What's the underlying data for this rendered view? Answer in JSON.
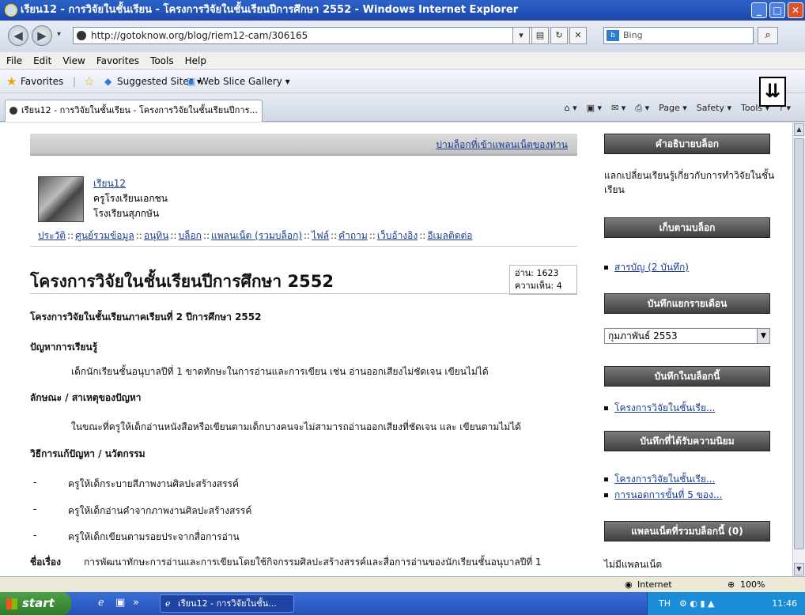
{
  "window": {
    "title": "เรียน12 - การวิจัยในชั้นเรียน - โครงการวิจัยในชั้นเรียนปีการศึกษา 2552 - Windows Internet Explorer"
  },
  "addressbar": {
    "url": "http://gotoknow.org/blog/riem12-cam/306165",
    "search_placeholder": "Bing"
  },
  "menu": [
    "File",
    "Edit",
    "View",
    "Favorites",
    "Tools",
    "Help"
  ],
  "favbar": {
    "favorites": "Favorites",
    "suggested": "Suggested Sites ▾",
    "webslice": "Web Slice Gallery ▾"
  },
  "tab": {
    "label": "เรียน12 - การวิจัยในชั้นเรียน - โครงการวิจัยในชั้นเรียนปีการ..."
  },
  "commandbar": [
    "Page ▾",
    "Safety ▾",
    "Tools ▾"
  ],
  "page": {
    "banner_link": "บ่ามล็อกที่เข้าแพลนเน็ตของท่าน",
    "profile": {
      "name": "เรียน12",
      "role": "ครูโรงเรียนเอกชน",
      "school": "โรงเรียนสุภกษัน"
    },
    "navlinks": [
      "ประวัติ",
      "ศูนย์รวมข้อมูล",
      "อนุทิน",
      "บล็อก",
      "แพลนเน็ต (รวมบล็อก)",
      "ไฟล์",
      "คำถาม",
      "เว็บอ้างอิง",
      "อีเมลติดต่อ"
    ],
    "title": "โครงการวิจัยในชั้นเรียนปีการศึกษา 2552",
    "stats": {
      "reads": "อ่าน: 1623",
      "comments": "ความเห็น: 4"
    },
    "subtitle": "โครงการวิจัยในชั้นเรียนภาคเรียนที่ 2  ปีการศึกษา  2552",
    "h_problem": "ปัญหาการเรียนรู้",
    "problem": "เด็กนักเรียนชั้นอนุบาลปีที่ 1 ขาดทักษะในการอ่านและการเขียน เช่น อ่านออกเสียงไม่ชัดเจน   เขียนไม่ได้",
    "h_cause": "ลักษณะ / สาเหตุของปัญหา",
    "cause": "ในขณะที่ครูให้เด็กอ่านหนังสือหรือเขียนตามเด็กบางคนจะไม่สามารถอ่านออกเสียงที่ชัดเจน และ เขียนตามไม่ได้",
    "h_solution": "วิธีการแก้ปัญหา / นวัตกรรม",
    "solutions": [
      "ครูให้เด็กระบายสีภาพงานศิลปะสร้างสรรค์",
      "ครูให้เด็กอ่านคำจากภาพงานศิลปะสร้างสรรค์",
      "ครูให้เด็กเขียนตามรอยประจากสื่อการอ่าน"
    ],
    "topic_label": "ชื่อเรื่อง",
    "topic": "การพัฒนาทักษะการอ่านและการเขียนโดยใช้กิจกรรมศิลปะสร้างสรรค์และสื่อการอ่านของนักเรียนชั้นอนุบาลปีที่ 1"
  },
  "sidebar": {
    "box1": "คำอธิบายบล็อก",
    "desc": "แลกเปลี่ยนเรียนรู้เกี่ยวกับการทำวิจัยในชั้นเรียน",
    "box2": "เก็บตามบล็อก",
    "item_general": "สารบัญ (2 บันทึก)",
    "box3": "บันทึกแยกรายเดือน",
    "month_select": "กุมภาพันธ์ 2553",
    "box4": "บันทึกในบล็อกนี้",
    "recent1": "โครงการวิจัยในชั้นเรีย...",
    "box5": "บันทึกที่ได้รับความนิยม",
    "popular1": "โครงการวิจัยในชั้นเรีย...",
    "popular2": "การนอดการขั้นที่ 5 ของ...",
    "box6": "แพลนเน็ตที่รวมบล็อกนี้ (0)",
    "noplanet": "ไม่มีแพลนเน็ต"
  },
  "status": {
    "zone": "Internet",
    "zoom": "100%"
  },
  "taskbar": {
    "start": "start",
    "item": "เรียน12 - การวิจัยในชั้น...",
    "lang": "TH",
    "time": "11:46"
  }
}
